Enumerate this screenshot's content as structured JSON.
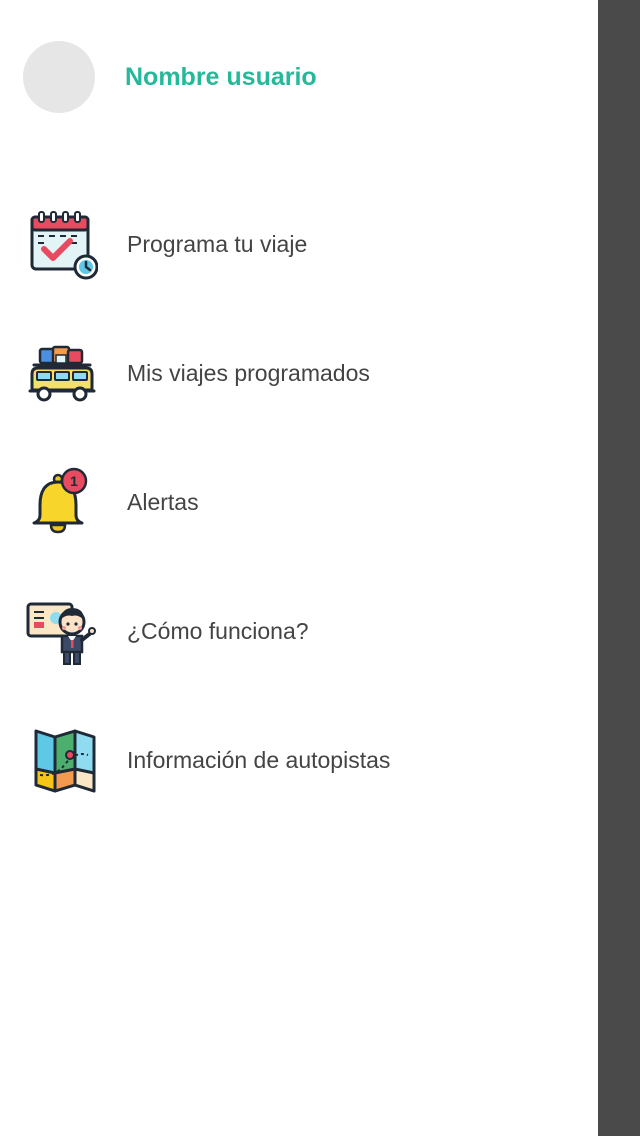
{
  "user": {
    "name": "Nombre usuario"
  },
  "menu": {
    "items": [
      {
        "label": "Programa tu viaje",
        "icon": "calendar-clock-icon"
      },
      {
        "label": "Mis viajes programados",
        "icon": "loaded-van-icon"
      },
      {
        "label": "Alertas",
        "icon": "bell-notification-icon",
        "badge": "1"
      },
      {
        "label": "¿Cómo funciona?",
        "icon": "presenter-board-icon"
      },
      {
        "label": "Información de autopistas",
        "icon": "folded-map-icon"
      }
    ]
  },
  "colors": {
    "accent": "#26b89a",
    "scrim": "#4a4a4a",
    "avatar_placeholder": "#e6e6e6",
    "label_text": "#444444"
  }
}
